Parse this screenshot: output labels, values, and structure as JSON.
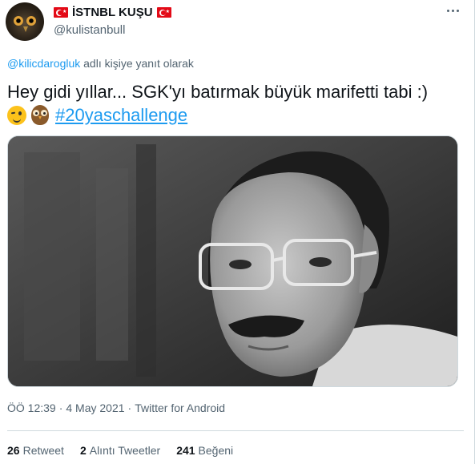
{
  "author": {
    "display_name": "İSTNBL KUŞU",
    "handle": "@kulistanbull",
    "avatar_icon": "owl-avatar",
    "flag_icon": "turkish-flag-icon"
  },
  "reply": {
    "mention": "@kilicdarogluk",
    "suffix": "adlı kişiye yanıt olarak"
  },
  "tweet": {
    "text": "Hey gidi yıllar... SGK'yı batırmak büyük marifetti tabi :)",
    "emojis": [
      "winking-face-icon",
      "owl-icon"
    ],
    "hashtag": "#20yaschallenge"
  },
  "media": {
    "type": "black-and-white photo of a man with glasses and mustache"
  },
  "meta": {
    "time": "ÖÖ 12:39",
    "sep1": "·",
    "date": "4 May 2021",
    "sep2": "·",
    "source": "Twitter for Android"
  },
  "stats": {
    "retweet_count": "26",
    "retweet_label": "Retweet",
    "quote_count": "2",
    "quote_label": "Alıntı Tweetler",
    "like_count": "241",
    "like_label": "Beğeni"
  },
  "colors": {
    "link": "#1d9bf0",
    "secondary_text": "#536471",
    "primary_text": "#0f1419",
    "flag_red": "#e30a17"
  }
}
